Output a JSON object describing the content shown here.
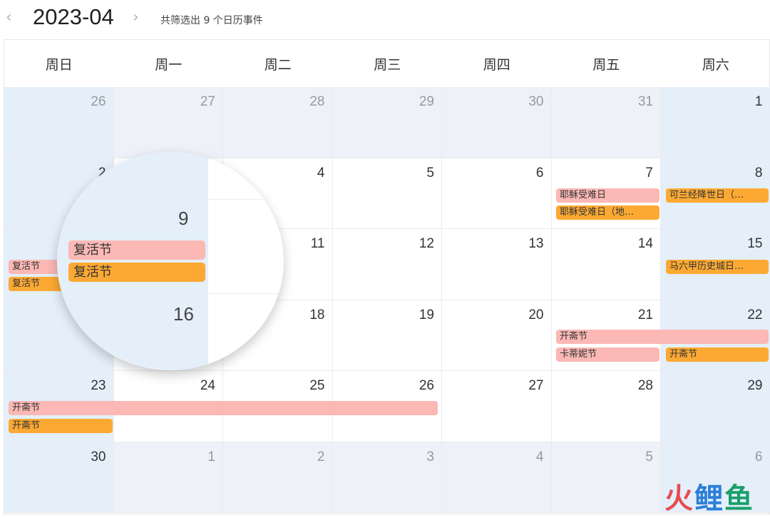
{
  "header": {
    "prev_icon": "‹",
    "next_icon": "›",
    "month": "2023-04",
    "summary": "共筛选出 9 个日历事件"
  },
  "weekdays": [
    "周日",
    "周一",
    "周二",
    "周三",
    "周四",
    "周五",
    "周六"
  ],
  "weeks": [
    [
      "26",
      "27",
      "28",
      "29",
      "30",
      "31",
      "1"
    ],
    [
      "2",
      "",
      "4",
      "5",
      "6",
      "7",
      "8"
    ],
    [
      "",
      "",
      "11",
      "12",
      "13",
      "14",
      "15"
    ],
    [
      "",
      "",
      "18",
      "19",
      "20",
      "21",
      "22"
    ],
    [
      "23",
      "24",
      "25",
      "26",
      "27",
      "28",
      "29"
    ],
    [
      "30",
      "1",
      "2",
      "3",
      "4",
      "5",
      "6"
    ]
  ],
  "events": {
    "good_friday_1": "耶稣受难日",
    "good_friday_2": "耶稣受难日（地…",
    "quran_day": "可兰经降世日（…",
    "easter_1": "复活节",
    "easter_2": "复活节",
    "malacca_day": "马六甲历史城日…",
    "eid_1": "开斋节",
    "kartini": "卡蒂妮节",
    "eid_2": "开斋节",
    "eid_3": "开斋节",
    "eid_4": "开斋节"
  },
  "magnifier": {
    "day_top": "9",
    "event_1": "复活节",
    "event_2": "复活节",
    "day_bottom": "16"
  },
  "watermark": {
    "char1": "火",
    "char2": "鲤",
    "char3": "鱼"
  },
  "colors": {
    "event_pink": "#fbb8b5",
    "event_orange": "#fca933",
    "weekend_bg": "#e4effa",
    "other_month_bg": "#eef1f8"
  }
}
